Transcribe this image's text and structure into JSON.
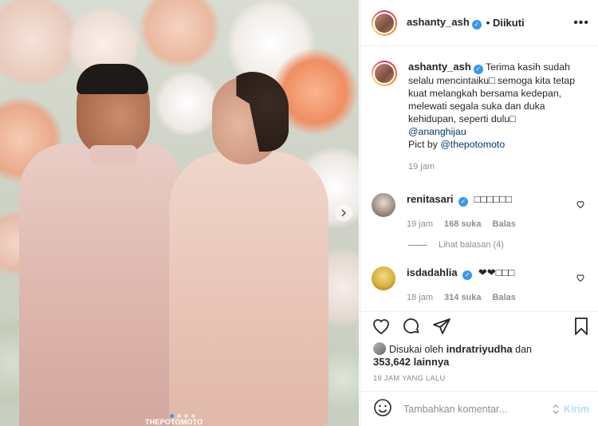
{
  "post": {
    "username": "ashanty_ash",
    "follow_status": "Diikuti",
    "watermark": "THEPOTOMOTO"
  },
  "caption": {
    "username": "ashanty_ash",
    "text": "Terima kasih sudah selalu mencintaiku□ semoga kita tetap kuat melangkah bersama kedepan, melewati segala suka dan duka kehidupan, seperti dulu□",
    "mention": "@ananghijau",
    "credit_prefix": "Pict by ",
    "credit_link": "@thepotomoto",
    "time": "19 jam"
  },
  "comments": [
    {
      "username": "renitasari",
      "text": "□□□□□□",
      "time": "19 jam",
      "likes": "168 suka",
      "reply": "Balas",
      "avatar_color": "#c9b8a8"
    },
    {
      "username": "isdadahlia",
      "text": "❤❤□□□",
      "time": "18 jam",
      "likes": "314 suka",
      "reply": "Balas",
      "avatar_color": "#d8b23a"
    }
  ],
  "view_replies": "Lihat balasan (4)",
  "likes": {
    "prefix": "Disukai oleh ",
    "user": "indratriyudha",
    "middle": " dan",
    "count": "353,642 lainnya"
  },
  "timestamp": "19 JAM YANG LALU",
  "comment_input": {
    "placeholder": "Tambahkan komentar...",
    "send_label": "Kirim"
  },
  "icons": {
    "more": "more-options-icon",
    "like": "heart-icon",
    "comment": "comment-icon",
    "share": "share-icon",
    "save": "bookmark-icon",
    "emoji": "emoji-icon"
  },
  "colors": {
    "verified": "#3897f0",
    "link": "#00376b",
    "muted": "#8e8e8e",
    "send_disabled": "#b2dffc"
  }
}
